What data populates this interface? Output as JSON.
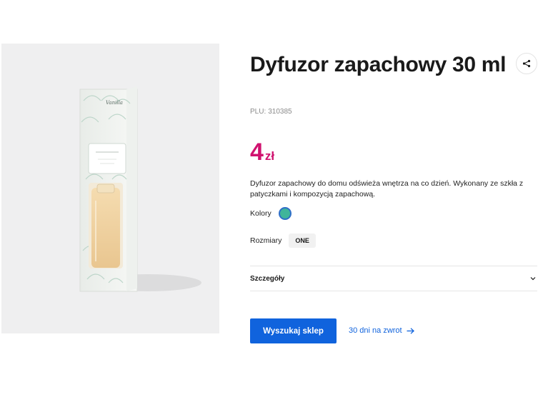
{
  "product": {
    "title": "Dyfuzor zapachowy 30 ml",
    "plu_label": "PLU:",
    "plu_value": "310385",
    "price_value": "4",
    "price_currency": "zł",
    "price_color": "#d0126f",
    "description": "Dyfuzor zapachowy do domu odświeża wnętrza na co dzień. Wykonany ze szkła z patyczkami i kompozycją zapachową.",
    "box_label": "Vanilla"
  },
  "colors": {
    "label": "Kolory",
    "selected_color": "#3fb59a"
  },
  "sizes": {
    "label": "Rozmiary",
    "options": [
      "ONE"
    ]
  },
  "details": {
    "label": "Szczegóły",
    "icon": "chevron-down-icon"
  },
  "actions": {
    "store_button_label": "Wyszukaj sklep",
    "store_button_color": "#1063dd",
    "return_link_label": "30 dni na zwrot",
    "return_link_icon": "arrow-right-icon",
    "share_icon": "share-icon"
  }
}
